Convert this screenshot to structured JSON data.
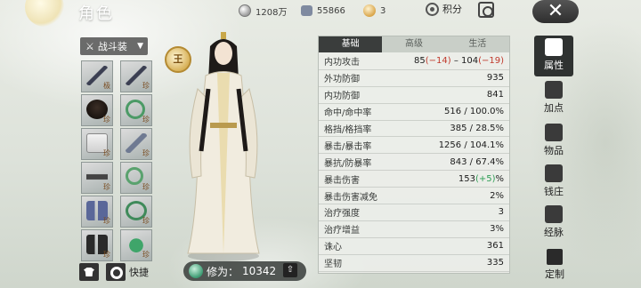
{
  "header": {
    "title": "角色",
    "currencies": [
      {
        "name": "coin-icon",
        "value": "1208万"
      },
      {
        "name": "ticket-icon",
        "value": "55866"
      },
      {
        "name": "ingot-icon",
        "value": "3"
      }
    ],
    "points_label": "积分"
  },
  "loadout": {
    "selected": "战斗装"
  },
  "equipment": [
    {
      "icon": "sword",
      "tag": "极"
    },
    {
      "icon": "sword",
      "tag": "珍"
    },
    {
      "icon": "hair",
      "tag": "珍"
    },
    {
      "icon": "jade",
      "tag": "珍"
    },
    {
      "icon": "robe",
      "tag": "珍"
    },
    {
      "icon": "fan",
      "tag": "珍"
    },
    {
      "icon": "belt",
      "tag": "珍"
    },
    {
      "icon": "ring",
      "tag": "珍"
    },
    {
      "icon": "legs",
      "tag": "珍"
    },
    {
      "icon": "bracelet",
      "tag": "珍"
    },
    {
      "icon": "boots",
      "tag": "珍"
    },
    {
      "icon": "pendant",
      "tag": "珍"
    }
  ],
  "quick_label": "快捷",
  "rank_badge": "王",
  "power": {
    "label": "修为：",
    "value": "10342"
  },
  "stats": {
    "tabs": [
      "基础",
      "高级",
      "生活"
    ],
    "active_tab": 0,
    "rows": [
      {
        "label": "内功攻击",
        "value": "85",
        "value2": "(−14)",
        "sep": " – ",
        "value3": "104",
        "value4": "(−19)"
      },
      {
        "label": "外功防御",
        "value": "935"
      },
      {
        "label": "内功防御",
        "value": "841"
      },
      {
        "label": "命中/命中率",
        "value": "516 / 100.0%"
      },
      {
        "label": "格挡/格挡率",
        "value": "385 / 28.5%"
      },
      {
        "label": "暴击/暴击率",
        "value": "1256 / 104.1%"
      },
      {
        "label": "暴抗/防暴率",
        "value": "843 / 67.4%"
      },
      {
        "label": "暴击伤害",
        "value": "153",
        "value_pos": "(+5)",
        "suffix": "%"
      },
      {
        "label": "暴击伤害减免",
        "value": "2%"
      },
      {
        "label": "治疗强度",
        "value": "3"
      },
      {
        "label": "治疗增益",
        "value": "3%"
      },
      {
        "label": "诛心",
        "value": "361"
      },
      {
        "label": "坚韧",
        "value": "335"
      }
    ]
  },
  "nav": {
    "items": [
      "属性",
      "加点",
      "物品",
      "钱庄",
      "经脉"
    ],
    "active": 0,
    "custom_label": "定制"
  }
}
